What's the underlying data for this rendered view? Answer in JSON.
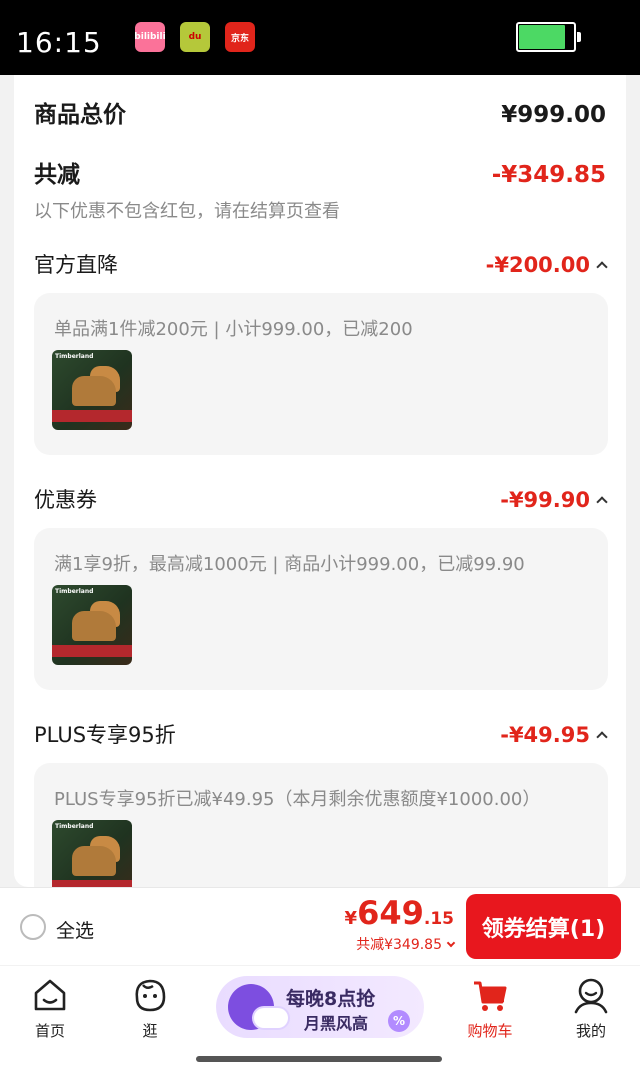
{
  "status_bar": {
    "time": "16:15",
    "apps": [
      "bilibili",
      "du",
      "京东"
    ],
    "battery_level": 0.85,
    "battery_color": "#4cd964"
  },
  "summary": {
    "total_label": "商品总价",
    "total_value": "¥999.00",
    "reduce_label": "共减",
    "reduce_value": "-¥349.85",
    "note": "以下优惠不包含红包，请在结算页查看"
  },
  "sections": [
    {
      "label": "官方直降",
      "value": "-¥200.00",
      "detail": "单品满1件减200元 | 小计999.00，已减200"
    },
    {
      "label": "优惠券",
      "value": "-¥99.90",
      "detail": "满1享9折，最高减1000元 | 商品小计999.00，已减99.90"
    },
    {
      "label": "PLUS专享95折",
      "value": "-¥49.95",
      "detail": "PLUS专享95折已减¥49.95（本月剩余优惠额度¥1000.00）"
    }
  ],
  "product_thumb": {
    "brand": "Timberland"
  },
  "checkout": {
    "select_all_label": "全选",
    "price_symbol": "¥",
    "price_int": "649",
    "price_dec": ".15",
    "price_reduce": "共减¥349.85",
    "button_label": "领券结算(1)",
    "accent_color": "#e8171e"
  },
  "tabs": [
    {
      "label": "首页",
      "icon": "home-icon"
    },
    {
      "label": "逛",
      "icon": "browse-icon"
    },
    {
      "label": "购物车",
      "icon": "cart-icon",
      "active": true
    },
    {
      "label": "我的",
      "icon": "profile-icon"
    }
  ],
  "promo": {
    "title": "每晚8点抢",
    "subtitle": "月黑风高",
    "badge": "%"
  }
}
